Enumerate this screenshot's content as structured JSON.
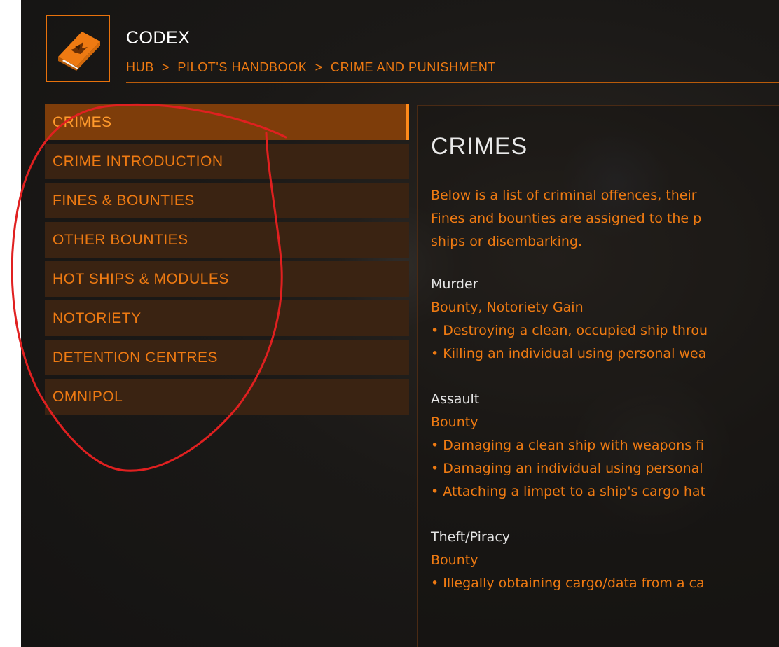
{
  "header": {
    "title": "CODEX",
    "breadcrumb": [
      "HUB",
      "PILOT'S HANDBOOK",
      "CRIME AND PUNISHMENT"
    ],
    "separator": ">"
  },
  "sidebar": {
    "items": [
      {
        "label": "CRIMES",
        "active": true
      },
      {
        "label": "CRIME INTRODUCTION"
      },
      {
        "label": "FINES & BOUNTIES"
      },
      {
        "label": "OTHER BOUNTIES"
      },
      {
        "label": "HOT SHIPS & MODULES"
      },
      {
        "label": "NOTORIETY"
      },
      {
        "label": "DETENTION CENTRES"
      },
      {
        "label": "OMNIPOL"
      }
    ]
  },
  "content": {
    "title": "CRIMES",
    "intro_lines": [
      "Below is a list of criminal offences, their",
      "Fines and bounties are assigned to the p",
      "ships or disembarking."
    ],
    "crimes": [
      {
        "name": "Murder",
        "penalty": "Bounty, Notoriety Gain",
        "details": [
          "• Destroying a clean, occupied ship throu",
          "• Killing an individual using personal wea"
        ]
      },
      {
        "name": "Assault",
        "penalty": "Bounty",
        "details": [
          "• Damaging a clean ship with weapons fi",
          "• Damaging an individual using personal",
          "• Attaching a limpet to a ship's cargo hat"
        ]
      },
      {
        "name": "Theft/Piracy",
        "penalty": "Bounty",
        "details": [
          "• Illegally obtaining cargo/data from a ca"
        ]
      }
    ]
  },
  "colors": {
    "accent": "#ee7a12",
    "active_bg": "#7e3d0a",
    "item_bg": "#3a2312",
    "annotation": "#e02020"
  },
  "icons": {
    "logo": "codex-book-icon"
  }
}
